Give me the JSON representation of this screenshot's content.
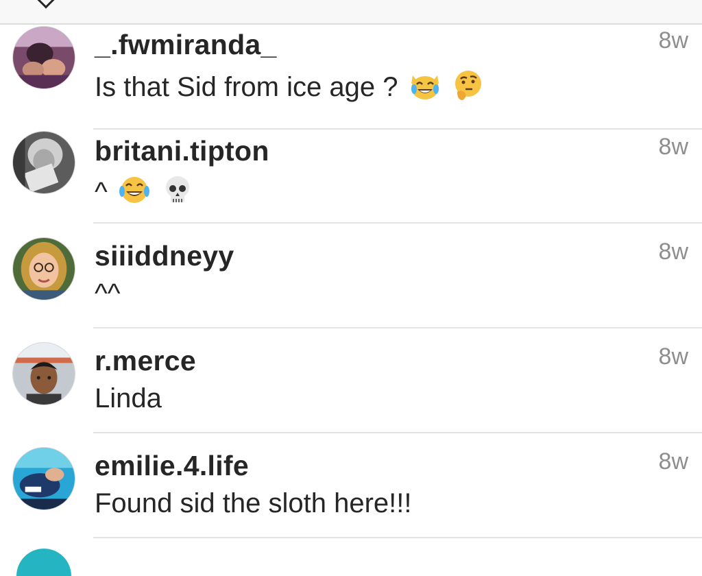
{
  "comments": [
    {
      "username": "_.fwmiranda_",
      "text": "Is that Sid from ice age ?",
      "time": "8w",
      "emojis": [
        "cat-tears-of-joy-icon",
        "thinking-face-icon"
      ]
    },
    {
      "username": "britani.tipton",
      "text": "^",
      "time": "8w",
      "emojis": [
        "face-with-tears-of-joy-icon",
        "skull-icon"
      ]
    },
    {
      "username": "siiiddneyy",
      "text": "^^",
      "time": "8w",
      "emojis": []
    },
    {
      "username": "r.merce",
      "text": "Linda",
      "time": "8w",
      "emojis": []
    },
    {
      "username": "emilie.4.life",
      "text": "Found sid the sloth here!!!",
      "time": "8w",
      "emojis": []
    }
  ],
  "colors": {
    "username": "#262626",
    "timestamp": "#8e8e8e",
    "divider": "#e3e3e3"
  }
}
